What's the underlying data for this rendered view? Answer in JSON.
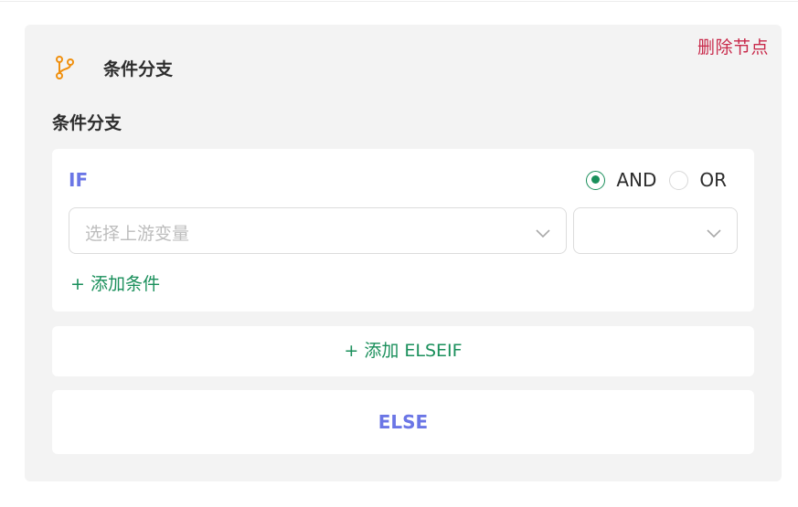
{
  "node": {
    "title": "条件分支",
    "delete_label": "删除节点",
    "icon": "git-branch-icon",
    "icon_color": "#f0900f"
  },
  "section": {
    "title": "条件分支"
  },
  "if_block": {
    "label": "IF",
    "logic": {
      "options": [
        {
          "label": "AND",
          "checked": true
        },
        {
          "label": "OR",
          "checked": false
        }
      ]
    },
    "variable_select": {
      "placeholder": "选择上游变量",
      "value": ""
    },
    "operator_select": {
      "value": ""
    },
    "add_condition_label": "+ 添加条件"
  },
  "elseif": {
    "add_label": "+ 添加 ELSEIF"
  },
  "else_block": {
    "label": "ELSE"
  },
  "colors": {
    "accent_green": "#1a8f5b",
    "if_blue": "#6b76e6",
    "danger_red": "#c8294a",
    "panel_bg": "#f3f3f3"
  }
}
